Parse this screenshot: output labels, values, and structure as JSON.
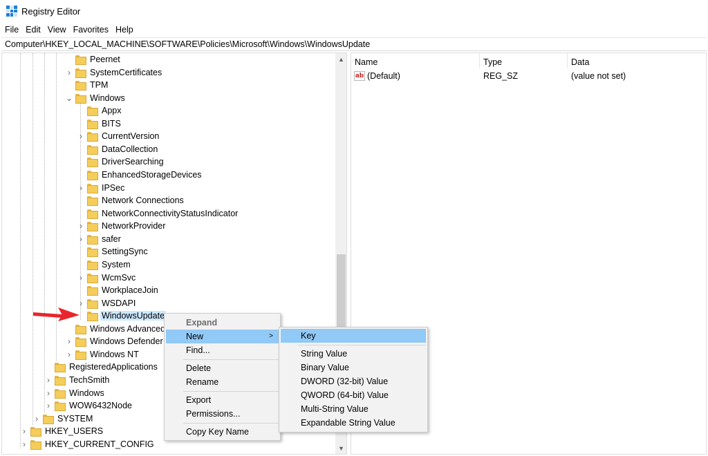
{
  "window": {
    "title": "Registry Editor"
  },
  "menubar": [
    "File",
    "Edit",
    "View",
    "Favorites",
    "Help"
  ],
  "address": "Computer\\HKEY_LOCAL_MACHINE\\SOFTWARE\\Policies\\Microsoft\\Windows\\WindowsUpdate",
  "tree": [
    {
      "label": "Peernet",
      "expander": ""
    },
    {
      "label": "SystemCertificates",
      "expander": "collapsed"
    },
    {
      "label": "TPM",
      "expander": ""
    },
    {
      "label": "Windows",
      "expander": "expanded"
    },
    {
      "label": "Appx",
      "expander": ""
    },
    {
      "label": "BITS",
      "expander": ""
    },
    {
      "label": "CurrentVersion",
      "expander": "collapsed"
    },
    {
      "label": "DataCollection",
      "expander": ""
    },
    {
      "label": "DriverSearching",
      "expander": ""
    },
    {
      "label": "EnhancedStorageDevices",
      "expander": ""
    },
    {
      "label": "IPSec",
      "expander": "collapsed"
    },
    {
      "label": "Network Connections",
      "expander": ""
    },
    {
      "label": "NetworkConnectivityStatusIndicator",
      "expander": ""
    },
    {
      "label": "NetworkProvider",
      "expander": "collapsed"
    },
    {
      "label": "safer",
      "expander": "collapsed"
    },
    {
      "label": "SettingSync",
      "expander": ""
    },
    {
      "label": "System",
      "expander": ""
    },
    {
      "label": "WcmSvc",
      "expander": "collapsed"
    },
    {
      "label": "WorkplaceJoin",
      "expander": ""
    },
    {
      "label": "WSDAPI",
      "expander": "collapsed"
    },
    {
      "label": "WindowsUpdate",
      "expander": "",
      "selected": true
    },
    {
      "label": "Windows Advanced",
      "expander": ""
    },
    {
      "label": "Windows Defender",
      "expander": "collapsed"
    },
    {
      "label": "Windows NT",
      "expander": "collapsed"
    },
    {
      "label": "RegisteredApplications",
      "expander": ""
    },
    {
      "label": "TechSmith",
      "expander": "collapsed"
    },
    {
      "label": "Windows",
      "expander": "collapsed"
    },
    {
      "label": "WOW6432Node",
      "expander": "collapsed"
    },
    {
      "label": "SYSTEM",
      "expander": "collapsed"
    },
    {
      "label": "HKEY_USERS",
      "expander": "collapsed"
    },
    {
      "label": "HKEY_CURRENT_CONFIG",
      "expander": "collapsed"
    }
  ],
  "values_list": {
    "columns": [
      "Name",
      "Type",
      "Data"
    ],
    "rows": [
      {
        "icon": "ab",
        "name": "(Default)",
        "type": "REG_SZ",
        "data": "(value not set)"
      }
    ]
  },
  "context_menu": [
    {
      "label": "Expand",
      "style": "bold"
    },
    {
      "label": "New",
      "submenu": true,
      "highlighted": true,
      "arrow": ">"
    },
    {
      "label": "Find..."
    },
    {
      "separator": true
    },
    {
      "label": "Delete"
    },
    {
      "label": "Rename"
    },
    {
      "separator": true
    },
    {
      "label": "Export"
    },
    {
      "label": "Permissions..."
    },
    {
      "separator": true
    },
    {
      "label": "Copy Key Name"
    }
  ],
  "submenu_new": [
    {
      "label": "Key",
      "highlighted": true
    },
    {
      "separator": true
    },
    {
      "label": "String Value"
    },
    {
      "label": "Binary Value"
    },
    {
      "label": "DWORD (32-bit) Value"
    },
    {
      "label": "QWORD (64-bit) Value"
    },
    {
      "label": "Multi-String Value"
    },
    {
      "label": "Expandable String Value"
    }
  ],
  "icons": {
    "chevron_collapsed": "›",
    "chevron_expanded": "⌄",
    "scroll_up": "▲",
    "scroll_down": "▼"
  },
  "colors": {
    "selection": "#cce8ff",
    "menu_highlight": "#91c9f7",
    "folder": "#f4cd5b",
    "arrow": "#e8262b"
  }
}
